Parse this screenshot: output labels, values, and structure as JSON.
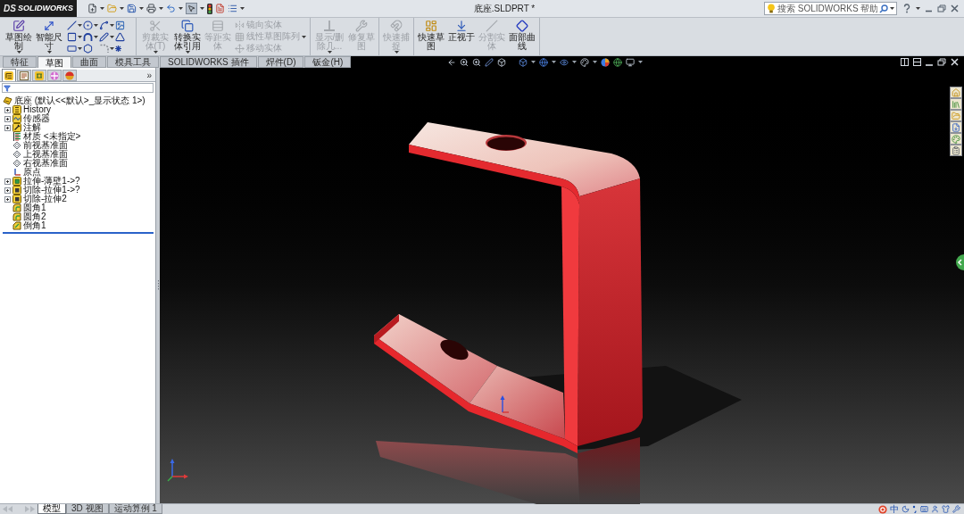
{
  "title_bar": {
    "logo_mark": "DS",
    "logo_text": "SOLIDWORKS",
    "document_title": "底座.SLDPRT *",
    "search": {
      "placeholder": "搜索 SOLIDWORKS 帮助"
    }
  },
  "ribbon": {
    "groups": [
      {
        "items": [
          {
            "kind": "button",
            "label": "草图绘制",
            "disabled": false,
            "dropdown": true
          },
          {
            "kind": "button",
            "label": "智能尺寸",
            "disabled": false,
            "dropdown": true
          },
          {
            "kind": "tools"
          }
        ]
      },
      {
        "items": [
          {
            "kind": "button",
            "label": "剪裁实体(T)",
            "disabled": true,
            "dropdown": true
          },
          {
            "kind": "button",
            "label": "转换实体引用",
            "disabled": false,
            "dropdown": true
          },
          {
            "kind": "button",
            "label": "等距实体",
            "disabled": true,
            "dropdown": false
          },
          {
            "kind": "stack",
            "dropdown": true,
            "items": [
              {
                "label": "镜向实体",
                "disabled": true
              },
              {
                "label": "线性草图阵列",
                "disabled": true
              },
              {
                "label": "移动实体",
                "disabled": true
              }
            ]
          }
        ]
      },
      {
        "items": [
          {
            "kind": "button",
            "label": "显示/删除几...",
            "disabled": true,
            "dropdown": true
          },
          {
            "kind": "button",
            "label": "修复草图",
            "disabled": true,
            "dropdown": false
          }
        ]
      },
      {
        "items": [
          {
            "kind": "button",
            "label": "快速捕捉",
            "disabled": true,
            "dropdown": true
          }
        ]
      },
      {
        "items": [
          {
            "kind": "button",
            "label": "快速草图",
            "disabled": false,
            "dropdown": false
          },
          {
            "kind": "button",
            "label": "正视于",
            "disabled": false,
            "dropdown": false
          },
          {
            "kind": "button",
            "label": "分割实体",
            "disabled": true,
            "dropdown": false
          },
          {
            "kind": "button",
            "label": "面部曲线",
            "disabled": false,
            "dropdown": false
          }
        ]
      }
    ]
  },
  "command_tabs": [
    {
      "label": "特征",
      "selected": false
    },
    {
      "label": "草图",
      "selected": true
    },
    {
      "label": "曲面",
      "selected": false
    },
    {
      "label": "模具工具",
      "selected": false
    },
    {
      "label": "SOLIDWORKS 插件",
      "selected": false
    },
    {
      "label": "焊件(D)",
      "selected": false
    },
    {
      "label": "钣金(H)",
      "selected": false
    }
  ],
  "feature_tree": {
    "tabs": [
      {
        "selected": true
      },
      {
        "selected": false
      },
      {
        "selected": false
      },
      {
        "selected": false
      },
      {
        "selected": false
      }
    ],
    "expand_glyph": "»",
    "root": {
      "label": "底座 (默认<<默认>_显示状态 1>)",
      "children": [
        {
          "label": "History",
          "kind": "history",
          "expandable": true
        },
        {
          "label": "传感器",
          "kind": "sensors",
          "expandable": true
        },
        {
          "label": "注解",
          "kind": "annotations",
          "expandable": true
        },
        {
          "label": "材质 <未指定>",
          "kind": "material",
          "expandable": false
        },
        {
          "label": "前视基准面",
          "kind": "plane",
          "expandable": false
        },
        {
          "label": "上视基准面",
          "kind": "plane",
          "expandable": false
        },
        {
          "label": "右视基准面",
          "kind": "plane",
          "expandable": false
        },
        {
          "label": "原点",
          "kind": "origin",
          "expandable": false
        },
        {
          "label": "拉伸-薄壁1->?",
          "kind": "extrude",
          "expandable": true
        },
        {
          "label": "切除-拉伸1->?",
          "kind": "cut",
          "expandable": true
        },
        {
          "label": "切除-拉伸2",
          "kind": "cut",
          "expandable": true
        },
        {
          "label": "圆角1",
          "kind": "fillet",
          "expandable": false
        },
        {
          "label": "圆角2",
          "kind": "fillet",
          "expandable": false
        },
        {
          "label": "倒角1",
          "kind": "chamfer",
          "expandable": false
        }
      ]
    }
  },
  "bottom_bar": {
    "tabs": [
      {
        "label": "模型",
        "selected": true
      },
      {
        "label": "3D 视图",
        "selected": false
      },
      {
        "label": "运动算例 1",
        "selected": false
      }
    ],
    "ime_mode": "中"
  }
}
